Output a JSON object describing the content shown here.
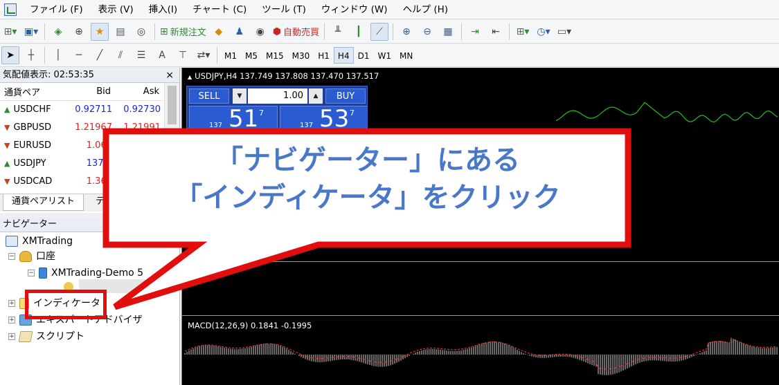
{
  "menu": [
    "ファイル (F)",
    "表示 (V)",
    "挿入(I)",
    "チャート (C)",
    "ツール (T)",
    "ウィンドウ (W)",
    "ヘルプ (H)"
  ],
  "toolbar": {
    "new_order_label": "新規注文",
    "auto_trading_label": "自動売買",
    "timeframes": [
      "M1",
      "M5",
      "M15",
      "M30",
      "H1",
      "H4",
      "D1",
      "W1",
      "MN"
    ],
    "active_timeframe": "H4",
    "text_tool_label": "A"
  },
  "market_watch": {
    "title": "気配値表示: 02:53:35",
    "close": "×",
    "columns": {
      "symbol": "通貨ペア",
      "bid": "Bid",
      "ask": "Ask"
    },
    "rows": [
      {
        "symbol": "USDCHF",
        "dir": "up",
        "bid": "0.92711",
        "ask": "0.92730"
      },
      {
        "symbol": "GBPUSD",
        "dir": "down",
        "bid": "1.21967",
        "ask": "1.21991"
      },
      {
        "symbol": "EURUSD",
        "dir": "down",
        "bid": "1.063",
        "ask": ""
      },
      {
        "symbol": "USDJPY",
        "dir": "up",
        "bid": "137.5",
        "ask": ""
      },
      {
        "symbol": "USDCAD",
        "dir": "down",
        "bid": "1.364",
        "ask": ""
      }
    ],
    "tabs": [
      "通貨ペアリスト",
      "テ"
    ]
  },
  "navigator": {
    "title": "ナビゲーター",
    "items": {
      "root": "XMTrading",
      "accounts": "口座",
      "server": "XMTrading-Demo 5",
      "indicators": "インディケータ",
      "experts": "エキスパートアドバイザ",
      "scripts": "スクリプト"
    }
  },
  "chart": {
    "header": "USDJPY,H4  137.749 137.808 137.470 137.517",
    "sell_label": "SELL",
    "buy_label": "BUY",
    "lot": "1.00",
    "sell_price": {
      "prefix": "137",
      "big": "51",
      "sup": "7"
    },
    "buy_price": {
      "prefix": "137",
      "big": "53",
      "sup": "7"
    },
    "macd_label": "MACD(12,26,9) 0.1841 -0.1995",
    "colors": {
      "price_line": "#22c21b",
      "macd_signal": "#e23030",
      "macd_hist": "#d0d0d0"
    }
  },
  "callout": {
    "line1": "「ナビゲーター」にある",
    "line2": "「インディケータ」をクリック",
    "border_color": "#e10e0e",
    "text_color": "#4a78c8"
  }
}
